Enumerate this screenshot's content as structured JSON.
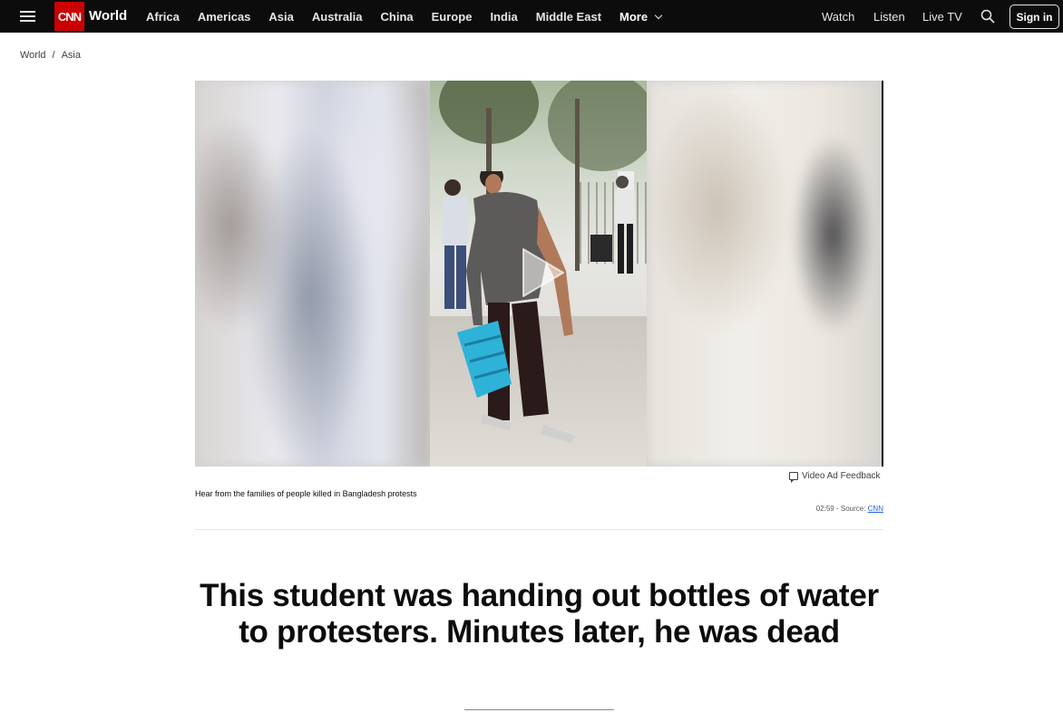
{
  "nav": {
    "brand": "CNN",
    "section": "World",
    "links": [
      "Africa",
      "Americas",
      "Asia",
      "Australia",
      "China",
      "Europe",
      "India",
      "Middle East"
    ],
    "more_label": "More",
    "watch": "Watch",
    "listen": "Listen",
    "live_tv": "Live TV",
    "sign_in": "Sign in"
  },
  "breadcrumb": [
    "World",
    "Asia"
  ],
  "video": {
    "ad_feedback": "Video Ad Feedback",
    "caption": "Hear from the families of people killed in Bangladesh protests",
    "duration": "02:59",
    "source_prefix": " - Source: ",
    "source": "CNN"
  },
  "article": {
    "headline": "This student was handing out bottles of water to protesters. Minutes later, he was dead"
  },
  "colors": {
    "nav_bg": "#0c0c0c",
    "brand_red": "#cc0000",
    "link_blue": "#2563eb"
  }
}
